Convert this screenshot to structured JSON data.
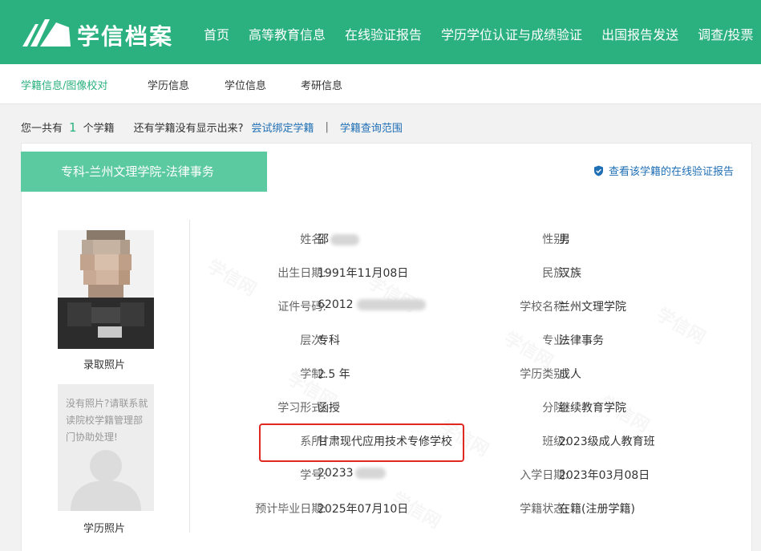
{
  "header": {
    "logo_text": "学信档案",
    "nav": [
      "首页",
      "高等教育信息",
      "在线验证报告",
      "学历学位认证与成绩验证",
      "出国报告发送",
      "调查/投票"
    ]
  },
  "subnav": [
    "学籍信息/图像校对",
    "学历信息",
    "学位信息",
    "考研信息"
  ],
  "countline": {
    "prefix": "您一共有",
    "count": "1",
    "suffix": "个学籍",
    "question": "还有学籍没有显示出来?",
    "link_bind": "尝试绑定学籍",
    "separator": "|",
    "link_scope": "学籍查询范围"
  },
  "card": {
    "tab_title": "专科-兰州文理学院-法律事务",
    "verify_link": "查看该学籍的在线验证报告",
    "photo_label": "录取照片",
    "placeholder_text": "没有照片?请联系就读院校学籍管理部门协助处理!",
    "placeholder_label": "学历照片",
    "watermark": "学信网"
  },
  "fields_left": [
    {
      "label": "姓名:",
      "value": "邵"
    },
    {
      "label": "出生日期:",
      "value": "1991年11月08日"
    },
    {
      "label": "证件号码:",
      "value": "62012"
    },
    {
      "label": "层次:",
      "value": "专科"
    },
    {
      "label": "学制:",
      "value": "2.5 年"
    },
    {
      "label": "学习形式:",
      "value": "函授"
    },
    {
      "label": "系所:",
      "value": "甘肃现代应用技术专修学校"
    },
    {
      "label": "学号:",
      "value": "20233"
    },
    {
      "label": "预计毕业日期:",
      "value": "2025年07月10日"
    }
  ],
  "fields_right": [
    {
      "label": "性别:",
      "value": "男"
    },
    {
      "label": "民族:",
      "value": "汉族"
    },
    {
      "label": "学校名称:",
      "value": "兰州文理学院"
    },
    {
      "label": "专业:",
      "value": "法律事务"
    },
    {
      "label": "学历类别:",
      "value": "成人"
    },
    {
      "label": "分院:",
      "value": "继续教育学院"
    },
    {
      "label": "班级:",
      "value": "2023级成人教育班"
    },
    {
      "label": "入学日期:",
      "value": "2023年03月08日"
    },
    {
      "label": "学籍状态:",
      "value": "在籍(注册学籍)"
    }
  ],
  "colors": {
    "brand_green": "#2bb17f",
    "tab_green": "#5ccaa0",
    "link_blue": "#1f6fb5",
    "highlight_red": "#e0281e"
  }
}
